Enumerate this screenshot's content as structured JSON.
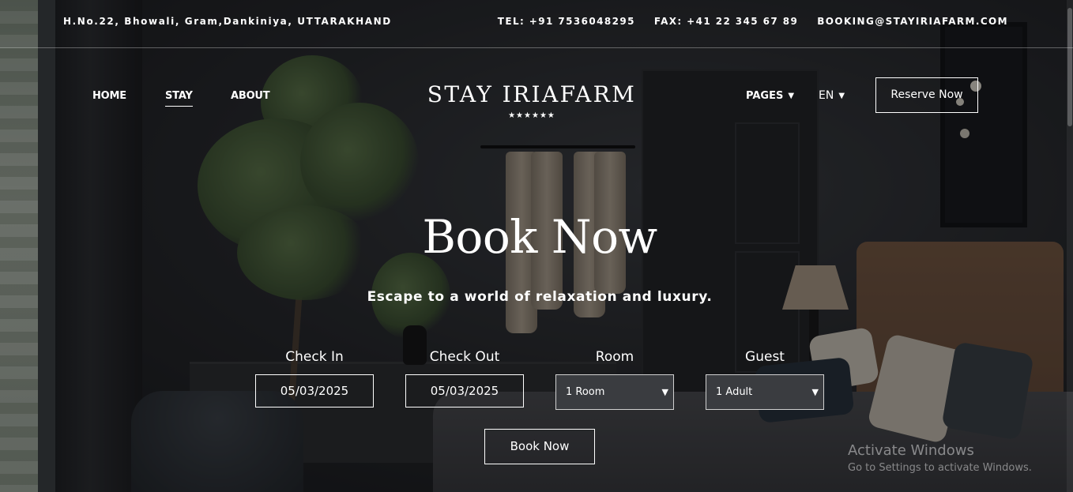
{
  "topbar": {
    "address": "H.No.22, Bhowali, Gram,Dankiniya, UTTARAKHAND",
    "tel": "TEL: +91 7536048295",
    "fax": "FAX: +41 22 345 67 89",
    "email": "BOOKING@STAYIRIAFARM.COM"
  },
  "nav": {
    "home": "HOME",
    "stay": "STAY",
    "about": "ABOUT",
    "pages": "PAGES",
    "language": "EN",
    "reserve": "Reserve Now"
  },
  "brand": {
    "title": "STAY IRIAFARM",
    "stars": "★★★★★★"
  },
  "hero": {
    "title": "Book Now",
    "subtitle": "Escape to a world of relaxation and luxury."
  },
  "booking": {
    "check_in_label": "Check In",
    "check_in_value": "05/03/2025",
    "check_out_label": "Check Out",
    "check_out_value": "05/03/2025",
    "room_label": "Room",
    "room_value": "1 Room",
    "guest_label": "Guest",
    "guest_value": "1 Adult",
    "submit": "Book Now"
  },
  "watermark": {
    "title": "Activate Windows",
    "subtitle": "Go to Settings to activate Windows."
  },
  "icons": {
    "dropdown": "chevron-down-icon",
    "stars": "star-icon"
  }
}
